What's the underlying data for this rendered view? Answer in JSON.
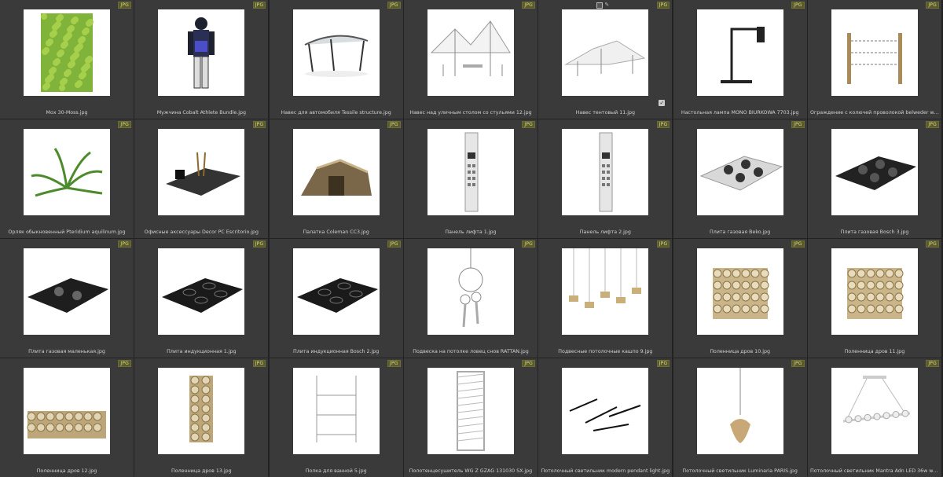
{
  "badge_label": "JPG",
  "files": [
    {
      "name": "Мох 30-Moss.jpg",
      "icon": "moss-panel-thumbnail"
    },
    {
      "name": "Мужчина Cobalt Athlete Bundle.jpg",
      "icon": "man-athlete-thumbnail"
    },
    {
      "name": "Навес для автомобиля Tessile structure.jpg",
      "icon": "car-canopy-thumbnail"
    },
    {
      "name": "Навес над уличным столом со стульями 12.jpg",
      "icon": "tent-table-thumbnail"
    },
    {
      "name": "Навес тентовый 11.jpg",
      "icon": "tent-canopy-thumbnail"
    },
    {
      "name": "Настольная лампа MONO BIURKOWA 7703.jpg",
      "icon": "desk-lamp-thumbnail"
    },
    {
      "name": "Ограждение с колючей проволокой belweder wieland.jpg",
      "icon": "barbed-fence-thumbnail"
    },
    {
      "name": "Орляк обыкновенный Pteridium aquilinum.jpg",
      "icon": "fern-thumbnail"
    },
    {
      "name": "Офисные аксессуары Decor PC Escritorio.jpg",
      "icon": "desk-accessories-thumbnail"
    },
    {
      "name": "Палатка Coleman CC3.jpg",
      "icon": "tent-thumbnail"
    },
    {
      "name": "Панель лифта 1.jpg",
      "icon": "elevator-panel-thumbnail"
    },
    {
      "name": "Панель лифта 2.jpg",
      "icon": "elevator-panel-thumbnail"
    },
    {
      "name": "Плита газовая Beko.jpg",
      "icon": "gas-stove-thumbnail"
    },
    {
      "name": "Плита газовая Bosch 3.jpg",
      "icon": "gas-stove-dark-thumbnail"
    },
    {
      "name": "Плита газовая маленькая.jpg",
      "icon": "small-gas-hob-thumbnail"
    },
    {
      "name": "Плита индукционная 1.jpg",
      "icon": "induction-hob-thumbnail"
    },
    {
      "name": "Плита индукционная Bosch 2.jpg",
      "icon": "induction-hob-thumbnail"
    },
    {
      "name": "Подвеска на потолке ловец снов RATTAN.jpg",
      "icon": "dreamcatcher-thumbnail"
    },
    {
      "name": "Подвесные потолочные кашпо 9.jpg",
      "icon": "hanging-planters-thumbnail"
    },
    {
      "name": "Поленница дров 10.jpg",
      "icon": "woodpile-thumbnail"
    },
    {
      "name": "Поленница дров 11.jpg",
      "icon": "woodpile-thumbnail"
    },
    {
      "name": "Поленница дров 12.jpg",
      "icon": "woodpile-long-thumbnail"
    },
    {
      "name": "Поленница дров 13.jpg",
      "icon": "woodpile-tower-thumbnail"
    },
    {
      "name": "Полка для ванной 5.jpg",
      "icon": "bathroom-shelf-thumbnail"
    },
    {
      "name": "Полотенцесушитель WG Z GZAG 131030 SX.jpg",
      "icon": "towel-warmer-thumbnail"
    },
    {
      "name": "Потолочный светильник modern pendant light.jpg",
      "icon": "pendant-light-thumbnail"
    },
    {
      "name": "Потолочный светильник Luminaria PARIS.jpg",
      "icon": "rattan-pendant-thumbnail"
    },
    {
      "name": "Потолочный светильник Mantra Adn LED 36w white Lines...",
      "icon": "linear-pendant-thumbnail"
    }
  ]
}
